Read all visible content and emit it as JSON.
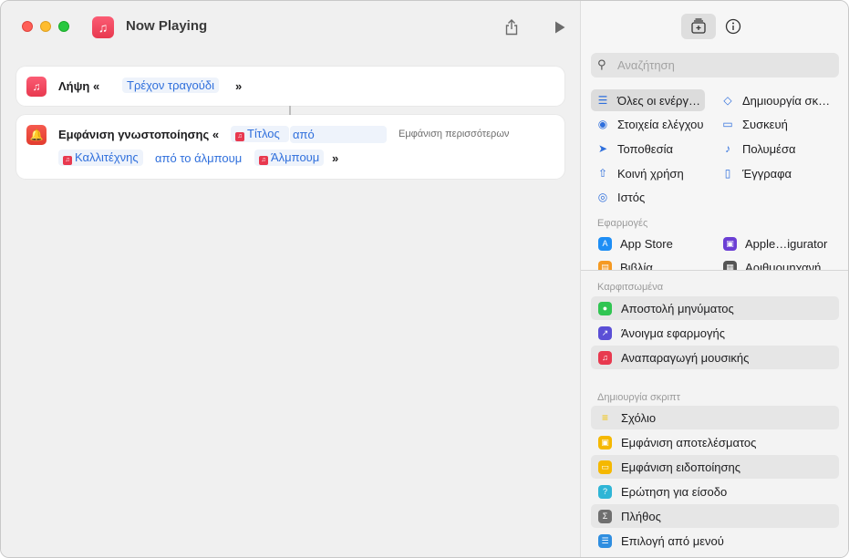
{
  "window": {
    "title": "Now Playing"
  },
  "toolbar": {
    "share_icon": "share-icon",
    "run_icon": "play-icon",
    "library_icon": "add-to-library-icon",
    "info_icon": "info-icon"
  },
  "editor": {
    "action1": {
      "label": "Λήψη «",
      "token": "Τρέχον τραγούδι",
      "close": "»"
    },
    "action2": {
      "label": "Εμφάνιση γνωστοποίησης «",
      "token_title": "Τίτλος",
      "text_from": "από",
      "show_more": "Εμφάνιση περισσότερων",
      "token_artist": "Καλλιτέχνης",
      "text_from_album": "από το άλμπουμ",
      "token_album": "Άλμπουμ",
      "close": "»"
    }
  },
  "sidebar": {
    "search_placeholder": "Αναζήτηση",
    "categories": {
      "all_actions": "Όλες οι ενέργ…",
      "scripting": "Δημιουργία σκ…",
      "controls": "Στοιχεία ελέγχου",
      "device": "Συσκευή",
      "location": "Τοποθεσία",
      "media": "Πολυμέσα",
      "sharing": "Κοινή χρήση",
      "documents": "Έγγραφα",
      "web": "Ιστός"
    },
    "apps_header": "Εφαρμογές",
    "apps": {
      "app_store": "App Store",
      "configurator": "Apple…igurator",
      "books": "Βιβλία",
      "calculator": "Αριθμομηχανή"
    },
    "pinned_header": "Καρφιτσωμένα",
    "pinned": [
      "Αποστολή μηνύματος",
      "Άνοιγμα εφαρμογής",
      "Αναπαραγωγή μουσικής"
    ],
    "scripting_header": "Δημιουργία σκριπτ",
    "scripting_items": [
      "Σχόλιο",
      "Εμφάνιση αποτελέσματος",
      "Εμφάνιση ειδοποίησης",
      "Ερώτηση για είσοδο",
      "Πλήθος",
      "Επιλογή από μενού"
    ]
  }
}
